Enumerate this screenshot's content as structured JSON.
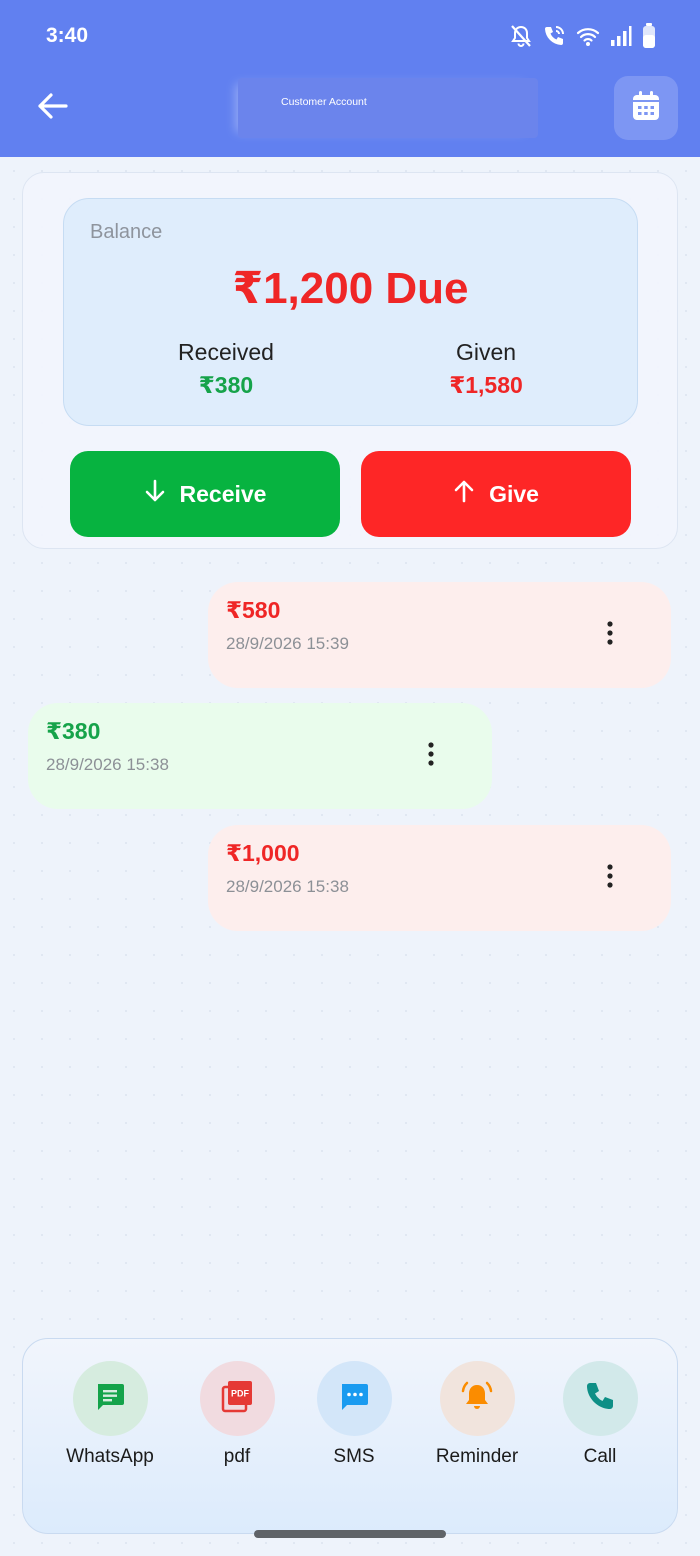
{
  "status_bar": {
    "time": "3:40"
  },
  "header": {
    "title": "Customer Account"
  },
  "summary": {
    "balance_label": "Balance",
    "balance_amount": "₹1,200 Due",
    "received_label": "Received",
    "received_value": "₹380",
    "given_label": "Given",
    "given_value": "₹1,580"
  },
  "actions": {
    "receive_label": "Receive",
    "give_label": "Give"
  },
  "transactions": [
    {
      "type": "given",
      "amount": "₹580",
      "date": "28/9/2026 15:39"
    },
    {
      "type": "received",
      "amount": "₹380",
      "date": "28/9/2026 15:38"
    },
    {
      "type": "given",
      "amount": "₹1,000",
      "date": "28/9/2026 15:38"
    }
  ],
  "share_bar": [
    {
      "label": "WhatsApp",
      "icon": "whatsapp-message-icon",
      "color": "#14a34a",
      "bg": "#d6ecdf"
    },
    {
      "label": "pdf",
      "icon": "pdf-icon",
      "color": "#e53935",
      "bg": "#f1dbe0"
    },
    {
      "label": "SMS",
      "icon": "sms-icon",
      "color": "#1a9bf0",
      "bg": "#d3e6f9"
    },
    {
      "label": "Reminder",
      "icon": "bell-ring-icon",
      "color": "#fb8c00",
      "bg": "#f1e4dd"
    },
    {
      "label": "Call",
      "icon": "phone-icon",
      "color": "#0e8f86",
      "bg": "#d2e9ea"
    }
  ],
  "colors": {
    "header": "#6180f0",
    "due_red": "#ef2626",
    "received_green": "#16a34a",
    "receive_button": "#07b340",
    "give_button": "#fe2626"
  }
}
